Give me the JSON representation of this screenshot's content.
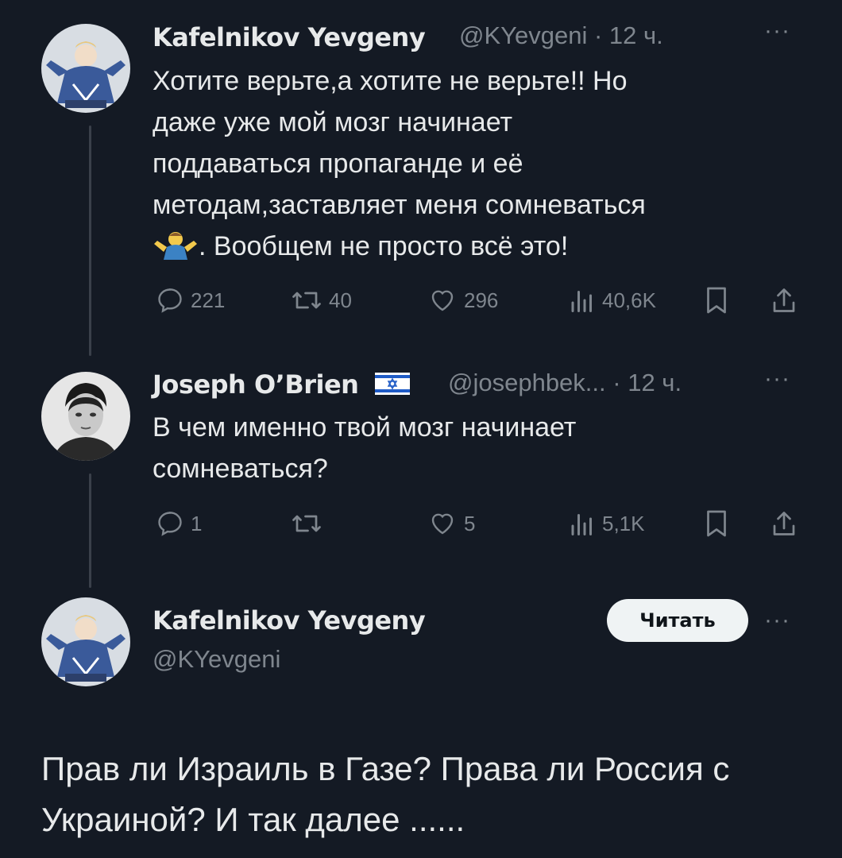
{
  "tweets": [
    {
      "name": "Kafelnikov Yevgeny",
      "handle": "@KYevgeni",
      "time": "· 12 ч.",
      "more": "···",
      "text_lines": [
        "Хотите верьте,а хотите не верьте!! Но",
        "даже уже мой мозг начинает",
        "поддаваться пропаганде и её",
        "методам,заставляет меня сомневаться",
        ". Вообщем не просто всё это!"
      ],
      "emoji": "man-shrugging-emoji",
      "replies": "221",
      "retweets": "40",
      "likes": "296",
      "views": "40,6K"
    },
    {
      "name": "Joseph O’Brien",
      "flag": "israel-flag-icon",
      "handle": "@josephbek...",
      "time": "· 12 ч.",
      "more": "···",
      "text_lines": [
        "В чем именно твой мозг начинает",
        "сомневаться?"
      ],
      "replies": "1",
      "retweets": "",
      "likes": "5",
      "views": "5,1K"
    }
  ],
  "profile": {
    "name": "Kafelnikov Yevgeny",
    "handle": "@KYevgeni",
    "follow_label": "Читать",
    "more": "···"
  },
  "main_post": {
    "text_lines": [
      "Прав ли Израиль в Газе? Права ли Россия с",
      "Украиной? И так далее ......"
    ]
  },
  "icons": [
    "reply-icon",
    "retweet-icon",
    "like-icon",
    "views-icon",
    "bookmark-icon",
    "share-icon"
  ],
  "colors": {
    "background": "#141a24",
    "text": "#e7e9ea",
    "muted": "#7f868e",
    "button_bg": "#eff3f4"
  }
}
